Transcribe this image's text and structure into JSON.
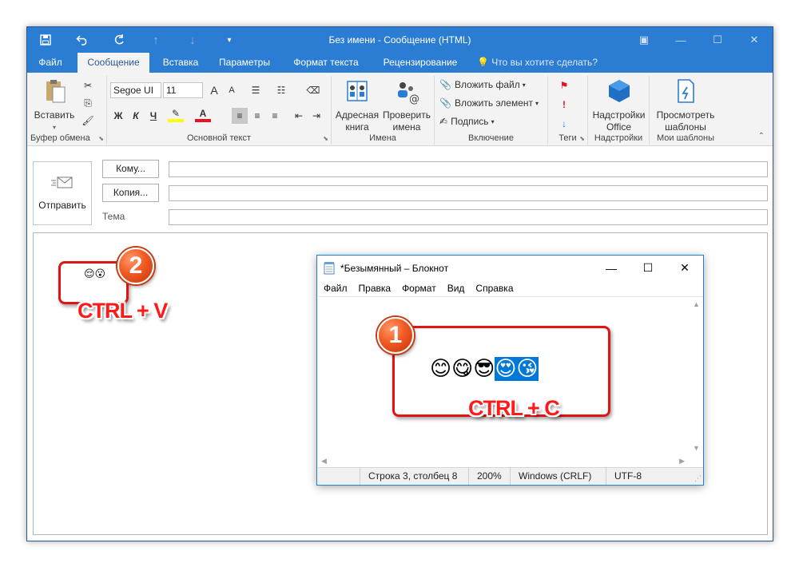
{
  "outlook": {
    "window_title": "Без имени - Сообщение (HTML)",
    "qat": {
      "save_icon": "save-icon",
      "undo_icon": "undo-icon",
      "redo_icon": "redo-icon",
      "up_icon": "arrow-up-icon",
      "down_icon": "arrow-down-icon",
      "customize_icon": "customize-icon"
    },
    "tabs": [
      {
        "label": "Файл"
      },
      {
        "label": "Сообщение"
      },
      {
        "label": "Вставка"
      },
      {
        "label": "Параметры"
      },
      {
        "label": "Формат текста"
      },
      {
        "label": "Рецензирование"
      }
    ],
    "tell_me": "Что вы хотите сделать?",
    "ribbon": {
      "clipboard": {
        "paste_label": "Вставить",
        "group_label": "Буфер обмена"
      },
      "basic_text": {
        "font_name": "Segoe UI",
        "font_size": "11",
        "bold": "Ж",
        "italic": "К",
        "underline": "Ч",
        "grow": "A",
        "shrink": "A",
        "group_label": "Основной текст"
      },
      "names": {
        "address_book_line1": "Адресная",
        "address_book_line2": "книга",
        "check_names_line1": "Проверить",
        "check_names_line2": "имена",
        "group_label": "Имена"
      },
      "include": {
        "attach_file": "Вложить файл",
        "attach_item": "Вложить элемент",
        "signature": "Подпись",
        "group_label": "Включение"
      },
      "tags": {
        "group_label": "Теги"
      },
      "addins": {
        "label_line1": "Надстройки",
        "label_line2": "Office",
        "group_label": "Надстройки"
      },
      "templates": {
        "label_line1": "Просмотреть",
        "label_line2": "шаблоны",
        "group_label": "Мои шаблоны"
      }
    },
    "header": {
      "send_label": "Отправить",
      "to_label": "Кому...",
      "cc_label": "Копия...",
      "subject_label": "Тема"
    },
    "body": {
      "pasted_text": "😌😮"
    }
  },
  "notepad": {
    "title": "*Безымянный – Блокнот",
    "menu": [
      "Файл",
      "Правка",
      "Формат",
      "Вид",
      "Справка"
    ],
    "text_plain": "😊😋😎",
    "text_selected": "😍😘",
    "status": {
      "position": "Строка 3, столбец 8",
      "zoom": "200%",
      "line_ending": "Windows (CRLF)",
      "encoding": "UTF-8"
    }
  },
  "annotations": {
    "step1_number": "1",
    "step1_hotkey": "CTRL + C",
    "step2_number": "2",
    "step2_hotkey": "CTRL + V",
    "highlight_color": "#e01414",
    "badge_color": "#f25a22"
  },
  "colors": {
    "accent": "#2b7cd3",
    "selection": "#0078d7"
  }
}
